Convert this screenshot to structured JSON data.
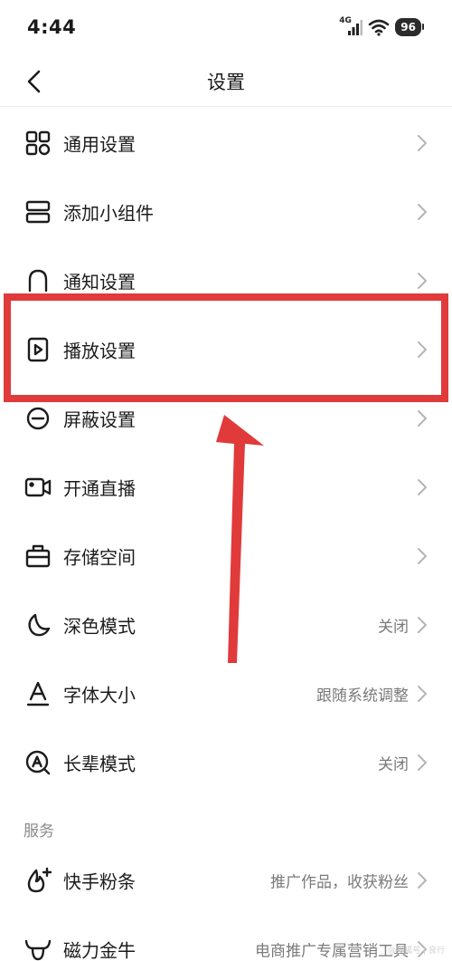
{
  "status_bar": {
    "time": "4:44",
    "network": "4G",
    "battery": "96"
  },
  "header": {
    "title": "设置"
  },
  "settings_items": [
    {
      "key": "general",
      "label": "通用设置",
      "value": "",
      "icon": "grid-icon"
    },
    {
      "key": "widgets",
      "label": "添加小组件",
      "value": "",
      "icon": "widget-icon"
    },
    {
      "key": "notifications",
      "label": "通知设置",
      "value": "",
      "icon": "bell-icon"
    },
    {
      "key": "playback",
      "label": "播放设置",
      "value": "",
      "icon": "play-icon"
    },
    {
      "key": "block",
      "label": "屏蔽设置",
      "value": "",
      "icon": "block-icon"
    },
    {
      "key": "live",
      "label": "开通直播",
      "value": "",
      "icon": "video-camera-icon"
    },
    {
      "key": "storage",
      "label": "存储空间",
      "value": "",
      "icon": "briefcase-icon"
    },
    {
      "key": "dark_mode",
      "label": "深色模式",
      "value": "关闭",
      "icon": "moon-icon"
    },
    {
      "key": "font_size",
      "label": "字体大小",
      "value": "跟随系统调整",
      "icon": "font-icon"
    },
    {
      "key": "elder_mode",
      "label": "长辈模式",
      "value": "关闭",
      "icon": "elder-icon"
    }
  ],
  "services_section": {
    "title": "服务",
    "items": [
      {
        "key": "fans",
        "label": "快手粉条",
        "value": "推广作品，收获粉丝",
        "icon": "fire-plus-icon"
      },
      {
        "key": "magnetic",
        "label": "磁力金牛",
        "value": "电商推广专属营销工具",
        "icon": "bull-icon"
      }
    ]
  },
  "annotation": {
    "highlight_color": "#e03a3a",
    "highlighted_item": "播放设置"
  },
  "watermark": "@搜狐号 | 良行"
}
